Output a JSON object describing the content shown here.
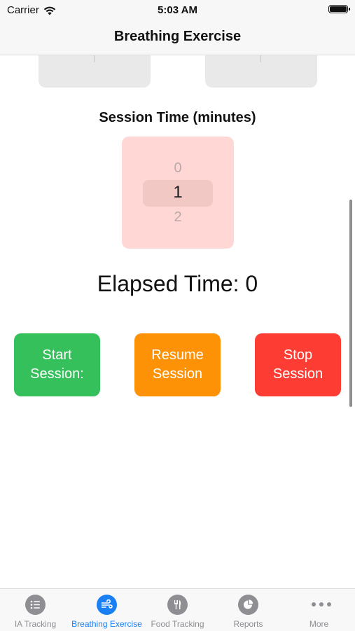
{
  "status_bar": {
    "carrier": "Carrier",
    "time": "5:03 AM"
  },
  "nav": {
    "title": "Breathing Exercise"
  },
  "session": {
    "label": "Session Time (minutes)",
    "picker": {
      "prev": "0",
      "selected": "1",
      "next": "2"
    }
  },
  "elapsed": {
    "text": "Elapsed Time: 0"
  },
  "buttons": {
    "start": {
      "label": "Start\nSession:",
      "color": "#36c05b"
    },
    "resume": {
      "label": "Resume\nSession",
      "color": "#fd9207"
    },
    "stop": {
      "label": "Stop\nSession",
      "color": "#fd3d33"
    }
  },
  "tabs": [
    {
      "label": "IA Tracking",
      "icon": "list-icon",
      "active": false
    },
    {
      "label": "Breathing Exercise",
      "icon": "wind-icon",
      "active": true
    },
    {
      "label": "Food Tracking",
      "icon": "fork-knife-icon",
      "active": false
    },
    {
      "label": "Reports",
      "icon": "pie-chart-icon",
      "active": false
    },
    {
      "label": "More",
      "icon": "more-icon",
      "active": false
    }
  ],
  "colors": {
    "accent": "#1a7ff3",
    "inactive_tab": "#8e8e93",
    "picker_background": "#ffd8d6"
  }
}
